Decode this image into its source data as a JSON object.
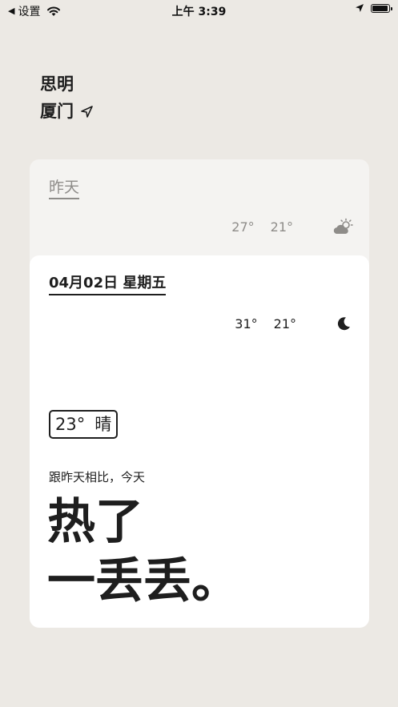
{
  "status_bar": {
    "back_label": "设置",
    "time": "上午 3:39",
    "battery_level": 0.95
  },
  "location": {
    "district": "思明",
    "city": "厦门"
  },
  "yesterday": {
    "label": "昨天",
    "high": "27°",
    "low": "21°",
    "icon": "partly-cloudy-icon"
  },
  "today": {
    "date": "04月02日 星期五",
    "high": "31°",
    "low": "21°",
    "icon": "moon-icon",
    "current_temp": "23°",
    "current_condition": "晴",
    "compare_text": "跟昨天相比，今天",
    "headline_line1": "热了",
    "headline_line2": "一丢丢。"
  },
  "colors": {
    "background": "#ece9e4",
    "text": "#1e1e1e",
    "muted": "#8e8c89"
  }
}
